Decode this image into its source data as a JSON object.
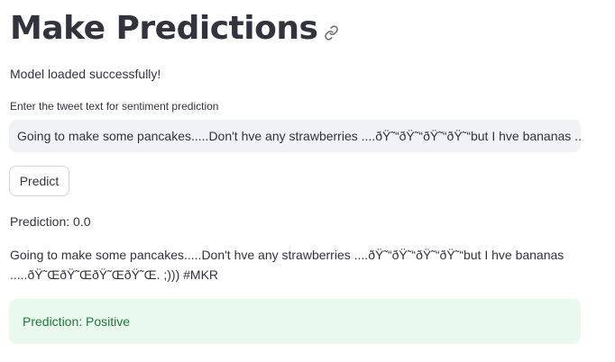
{
  "header": {
    "title": "Make Predictions"
  },
  "icons": {
    "anchor_link": "link-icon"
  },
  "status": {
    "model_loaded": "Model loaded successfully!"
  },
  "tweet_input": {
    "label": "Enter the tweet text for sentiment prediction",
    "value": "Going to make some pancakes.....Don't hve any strawberries ....ðŸ˜“ðŸ˜“ðŸ˜“ðŸ˜“but I hve bananas ..."
  },
  "actions": {
    "predict_label": "Predict"
  },
  "result": {
    "prediction_raw": "Prediction: 0.0",
    "echo_text": "Going to make some pancakes.....Don't hve any strawberries ....ðŸ˜“ðŸ˜“ðŸ˜“ðŸ˜“but I hve bananas .....ðŸ˜ŒðŸ˜ŒðŸ˜ŒðŸ˜Œ. ;))) #MKR",
    "sentiment_message": "Prediction: Positive"
  },
  "colors": {
    "text": "#31333f",
    "input_bg": "#f0f2f6",
    "success_bg": "#eaf9ee",
    "success_text": "#1f7a3a"
  }
}
